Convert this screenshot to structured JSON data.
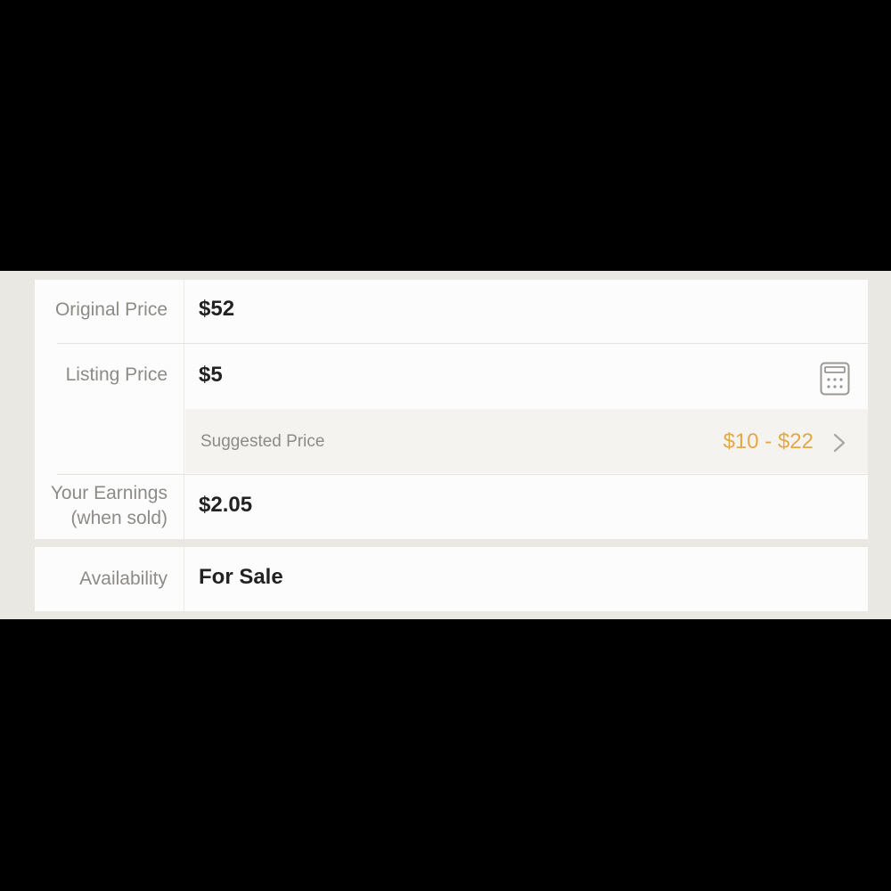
{
  "pricing": {
    "original_price": {
      "label": "Original Price",
      "value": "$52"
    },
    "listing_price": {
      "label": "Listing Price",
      "value": "$5"
    },
    "suggested_price": {
      "label": "Suggested Price",
      "range": "$10 - $22"
    },
    "earnings": {
      "label_line1": "Your Earnings",
      "label_line2": "(when sold)",
      "value": "$2.05"
    }
  },
  "availability": {
    "label": "Availability",
    "value": "For Sale"
  },
  "icons": {
    "calculator": "calculator-icon",
    "chevron": "chevron-right-icon"
  },
  "colors": {
    "accent": "#e0a94a",
    "label_gray": "#8d8b86",
    "value_text": "#222222"
  }
}
